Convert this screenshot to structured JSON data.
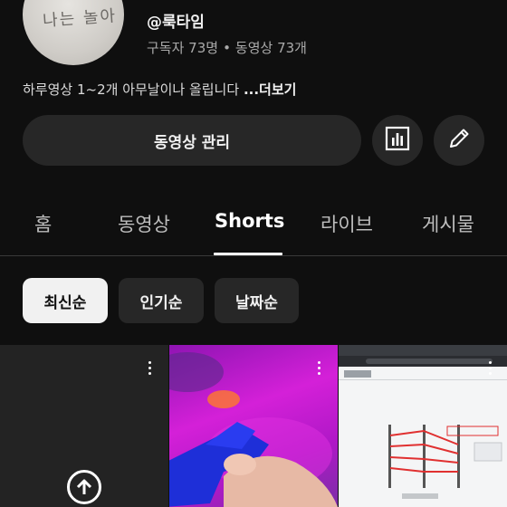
{
  "channel": {
    "avatar_text": "나는 놀아",
    "handle": "@룩타임",
    "subscribers": "구독자 73명",
    "separator": "•",
    "videos": "동영상 73개",
    "description": "하루영상 1~2개 아무날이나 올립니다",
    "more_label": "...더보기"
  },
  "actions": {
    "manage_label": "동영상 관리",
    "stats_icon": "bar-chart-icon",
    "edit_icon": "pencil-icon"
  },
  "tabs": [
    {
      "label": "홈"
    },
    {
      "label": "동영상"
    },
    {
      "label": "Shorts",
      "active": true
    },
    {
      "label": "라이브"
    },
    {
      "label": "게시물"
    }
  ],
  "chips": [
    {
      "label": "최신순",
      "selected": true
    },
    {
      "label": "인기순"
    },
    {
      "label": "날짜순"
    }
  ],
  "shorts": [
    {
      "kind": "processing",
      "icon": "upload-icon"
    },
    {
      "kind": "video"
    },
    {
      "kind": "video"
    }
  ],
  "colors": {
    "background": "#0f0f0f",
    "button": "#272727",
    "text_secondary": "#aaaaaa"
  }
}
